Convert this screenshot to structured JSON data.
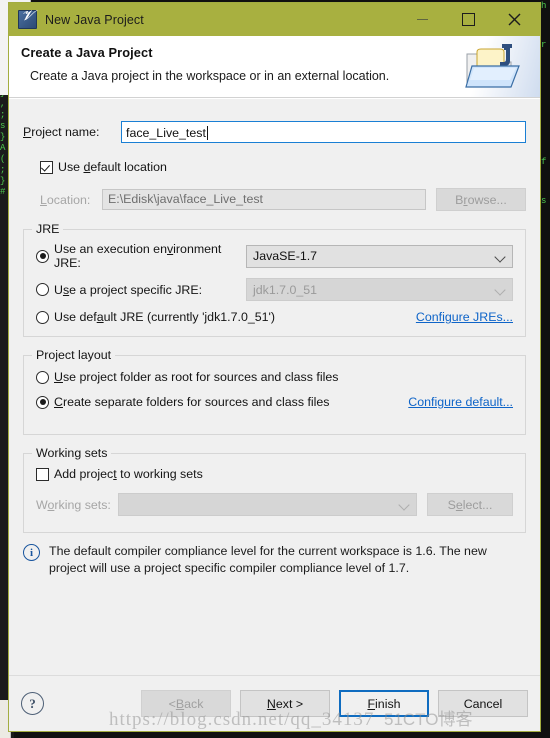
{
  "window": {
    "title": "New Java Project",
    "app_icon": "java-project-icon",
    "minimize_label": "Minimize",
    "maximize_label": "Maximize",
    "close_label": "Close",
    "titlebar_color": "#a8b040"
  },
  "banner": {
    "title": "Create a Java Project",
    "subtitle": "Create a Java project in the workspace or in an external location.",
    "icon": "java-folder-icon"
  },
  "form": {
    "project_name_label": "Project name:",
    "project_name_label_mnemonic": "P",
    "project_name_value": "face_Live_test",
    "use_default_location_label": "Use default location",
    "use_default_location_mnemonic": "d",
    "use_default_location_checked": true,
    "location_label": "Location:",
    "location_label_mnemonic": "L",
    "location_value": "E:\\Edisk\\java\\face_Live_test",
    "browse_label": "Browse...",
    "browse_mnemonic": "r",
    "browse_enabled": false
  },
  "jre": {
    "group_title": "JRE",
    "options": [
      {
        "label": "Use an execution environment JRE:",
        "mnemonic": "v",
        "selected": true,
        "combo_value": "JavaSE-1.7",
        "combo_enabled": true
      },
      {
        "label": "Use a project specific JRE:",
        "mnemonic": "s",
        "selected": false,
        "combo_value": "jdk1.7.0_51",
        "combo_enabled": false
      },
      {
        "label": "Use default JRE (currently 'jdk1.7.0_51')",
        "mnemonic": "a",
        "selected": false,
        "combo_value": "",
        "combo_enabled": false
      }
    ],
    "configure_link": "Configure JREs..."
  },
  "project_layout": {
    "group_title": "Project layout",
    "options": [
      {
        "label": "Use project folder as root for sources and class files",
        "mnemonic": "U",
        "selected": false
      },
      {
        "label": "Create separate folders for sources and class files",
        "mnemonic": "C",
        "selected": true
      }
    ],
    "configure_link": "Configure default..."
  },
  "working_sets": {
    "group_title": "Working sets",
    "add_label": "Add project to working sets",
    "add_mnemonic": "t",
    "add_checked": false,
    "sets_label": "Working sets:",
    "sets_mnemonic": "o",
    "sets_value": "",
    "select_label": "Select...",
    "select_mnemonic": "e",
    "select_enabled": false
  },
  "info": {
    "icon": "info-icon",
    "message": "The default compiler compliance level for the current workspace is 1.6. The new project will use a project specific compiler compliance level of 1.7."
  },
  "footer": {
    "help_label": "?",
    "buttons": [
      {
        "name": "back",
        "label": "< Back",
        "mnemonic": "B",
        "enabled": false,
        "default": false
      },
      {
        "name": "next",
        "label": "Next >",
        "mnemonic": "N",
        "enabled": true,
        "default": false
      },
      {
        "name": "finish",
        "label": "Finish",
        "mnemonic": "F",
        "enabled": true,
        "default": true
      },
      {
        "name": "cancel",
        "label": "Cancel",
        "mnemonic": "",
        "enabled": true,
        "default": false
      }
    ]
  },
  "watermark": {
    "url": "https://blog.csdn.net/qq_34137",
    "suffix": "51CTO博客"
  },
  "background": {
    "left_code": "}\n\nI\nI\nI\n-\n.\n)\n}\n,\n;\ns\n}\nA\n(\n;\n}\n#",
    "right_code": "h\n\n\nr\n\n\n\n\n\n\n\n\nf\n\n\ns"
  }
}
